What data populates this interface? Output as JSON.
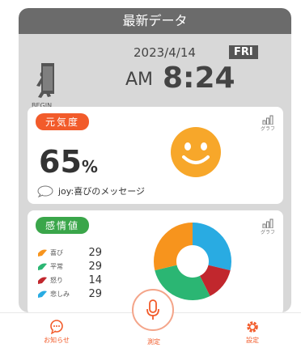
{
  "title": "最新データ",
  "header": {
    "date": "2023/4/14",
    "day_of_week": "FRI",
    "ampm": "AM",
    "time": "8:24",
    "begin_label": "BEGIN",
    "exit_icon": "exit-icon"
  },
  "energy_card": {
    "label": "元気度",
    "value": "65",
    "unit": "%",
    "graph_label": "グラフ",
    "message": "joy:喜びのメッセージ",
    "face_icon": "smiley-face-icon",
    "face_color": "#f7a72a"
  },
  "emotion_card": {
    "label": "感情値",
    "graph_label": "グラフ",
    "items": [
      {
        "label": "喜び",
        "value": 29,
        "color": "#f7941d"
      },
      {
        "label": "平常",
        "value": 29,
        "color": "#2bb673"
      },
      {
        "label": "怒り",
        "value": 14,
        "color": "#c1272d"
      },
      {
        "label": "悲しみ",
        "value": 29,
        "color": "#29abe2"
      }
    ]
  },
  "chart_data": {
    "type": "pie",
    "categories": [
      "喜び",
      "平常",
      "怒り",
      "悲しみ"
    ],
    "values": [
      29,
      29,
      14,
      29
    ],
    "donut": true,
    "colors": [
      "#f7941d",
      "#2bb673",
      "#c1272d",
      "#29abe2"
    ]
  },
  "bottom_nav": {
    "notice_label": "お知らせ",
    "measure_label": "測定",
    "settings_label": "設定"
  },
  "colors": {
    "accent": "#f25b2a",
    "green_pill": "#3aa64a",
    "dark_bar": "#6b6b6b"
  }
}
